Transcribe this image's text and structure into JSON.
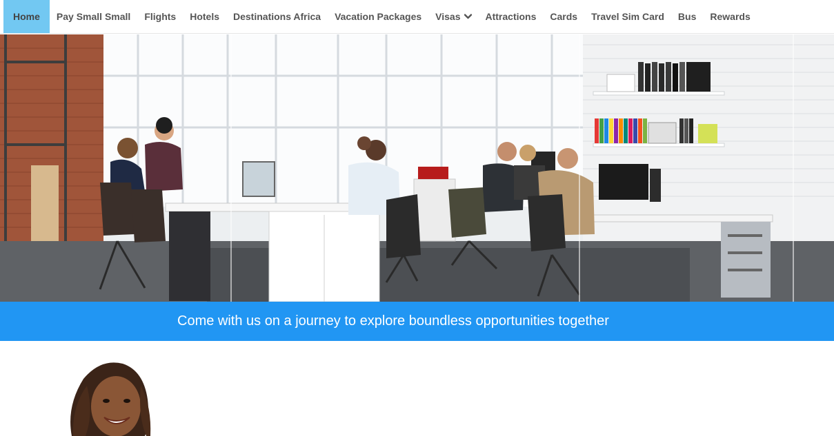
{
  "nav": {
    "items": [
      {
        "label": "Home",
        "active": true
      },
      {
        "label": "Pay Small Small"
      },
      {
        "label": "Flights"
      },
      {
        "label": "Hotels"
      },
      {
        "label": "Destinations Africa"
      },
      {
        "label": "Vacation Packages"
      },
      {
        "label": "Visas",
        "dropdown": true
      },
      {
        "label": "Attractions"
      },
      {
        "label": "Cards"
      },
      {
        "label": "Travel Sim Card"
      },
      {
        "label": "Bus"
      },
      {
        "label": "Rewards"
      }
    ],
    "accent_color": "#72c8f2"
  },
  "banner": {
    "text": "Come with us on a journey to explore boundless opportunities together",
    "color": "#2196f3"
  },
  "icons": {
    "dropdown": "chevron-down-icon"
  }
}
